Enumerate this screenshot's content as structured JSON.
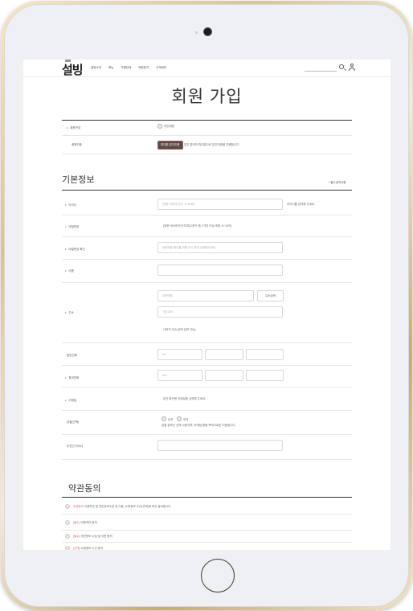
{
  "header": {
    "logo_text": "설빙",
    "nav": [
      "설빙소개",
      "메뉴",
      "가맹안내",
      "매장찾기",
      "고객센터"
    ]
  },
  "page_title": "회원 가입",
  "membership": {
    "type_label": "회원구분",
    "type_option": "개인회원",
    "auth_label": "회원인증",
    "auth_button": "휴대폰 본인인증",
    "auth_note": "본인 명의의 휴대폰으로 본인인증을 진행합니다."
  },
  "basic_info": {
    "section_title": "기본정보",
    "required_note": "필수입력사항",
    "fields": {
      "id_label": "아이디",
      "id_placeholder": "(영문 소문자/숫자, 4~16자)",
      "id_hint": "아이디를 입력해 주세요.",
      "password_label": "비밀번호",
      "password_hint": "(영문 대소문자/숫자/특수문자 중 2가지 이상 조합, 8~16자)",
      "password_confirm_label": "비밀번호 확인",
      "password_confirm_placeholder": "비밀번호 확인을 위해 다시 한번 입력해주세요.",
      "name_label": "이름",
      "address_label": "주소",
      "zipcode_placeholder": "우편번호",
      "zipcode_button": "주소검색",
      "address1_placeholder": "기본주소",
      "address2_placeholder": "나머지 주소(선택 입력 가능)",
      "landline_label": "일반전화",
      "landline_prefix": "02",
      "mobile_label": "휴대전화",
      "mobile_prefix": "010",
      "email_label": "이메일",
      "email_hint": "본인 확인용 이메일을 입력해 주세요.",
      "gender_label": "성별(선택)",
      "gender_options": [
        "남자",
        "여자"
      ],
      "gender_hint": "성별 정보는 선택 사항이며, 마케팅 활용 목적으로만 이용됩니다.",
      "referrer_label": "추천인 아이디"
    }
  },
  "terms": {
    "section_title": "약관동의",
    "items": [
      {
        "link": "전체동의",
        "text": "이용약관 및 개인정보수집 및 이용, 쇼핑정보 수신(선택)에 모두 동의합니다."
      },
      {
        "link": "[필수]",
        "text": "이용약관 동의"
      },
      {
        "link": "[필수]",
        "text": "개인정보 수집 및 이용 동의"
      },
      {
        "link": "[선택]",
        "text": "쇼핑정보 수신 동의"
      }
    ]
  }
}
